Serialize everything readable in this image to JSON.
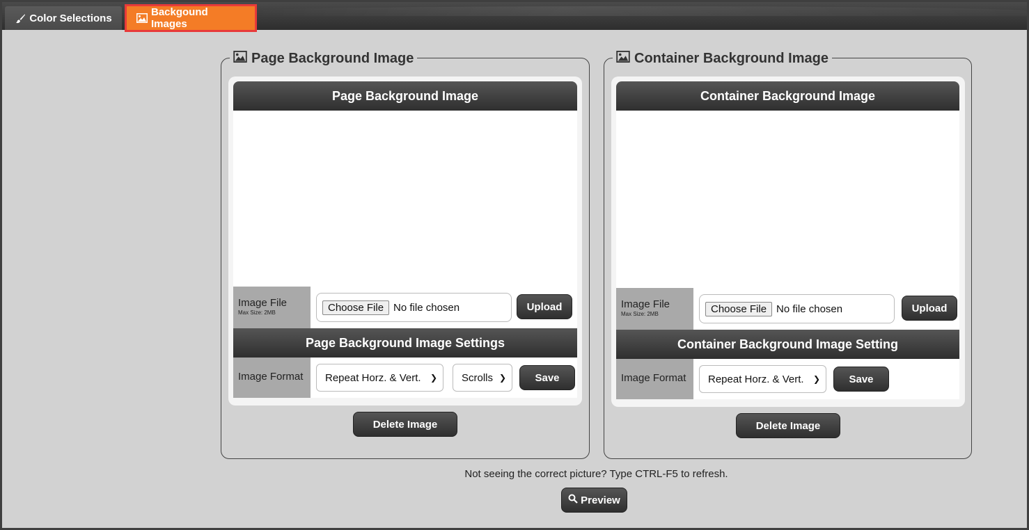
{
  "tabs": [
    {
      "label": "Color Selections",
      "icon": "paintbrush-icon",
      "active": false
    },
    {
      "label": "Backgound Images",
      "icon": "image-icon",
      "active": true
    }
  ],
  "colors": {
    "accent": "#f47c26",
    "active_border": "#e83a3a",
    "dark": "#3a3a3a",
    "panel_bg": "#d2d2d2"
  },
  "page_panel": {
    "legend": "Page Background Image",
    "header": "Page Background Image",
    "image_file_label": "Image File",
    "max_size": "Max Size: 2MB",
    "choose_file_label": "Choose File",
    "file_status": "No file chosen",
    "upload_label": "Upload",
    "settings_header": "Page Background Image Settings",
    "format_label": "Image Format",
    "format_value": "Repeat Horz. & Vert.",
    "scroll_value": "Scrolls",
    "save_label": "Save",
    "delete_label": "Delete Image"
  },
  "container_panel": {
    "legend": "Container Background Image",
    "header": "Container Background Image",
    "image_file_label": "Image File",
    "max_size": "Max Size: 2MB",
    "choose_file_label": "Choose File",
    "file_status": "No file chosen",
    "upload_label": "Upload",
    "settings_header": "Container Background Image Setting",
    "format_label": "Image Format",
    "format_value": "Repeat Horz. & Vert.",
    "save_label": "Save",
    "delete_label": "Delete Image"
  },
  "refresh_note": "Not seeing the correct picture? Type CTRL-F5 to refresh.",
  "preview_label": "Preview"
}
